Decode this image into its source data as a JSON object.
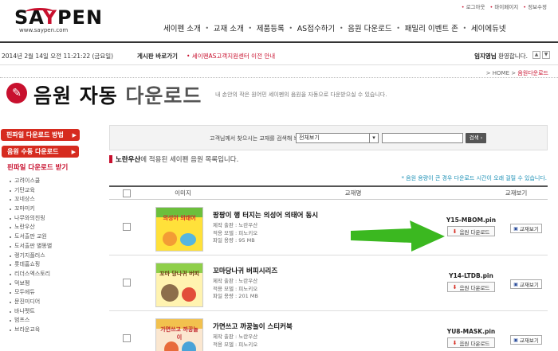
{
  "top_links": [
    "로그아웃",
    "마이페이지",
    "정보수정"
  ],
  "logo": {
    "name_prefix": "SA",
    "name_accent": "Y",
    "name_suffix": "PEN",
    "url": "www.saypen.com"
  },
  "gnb": [
    "세이펜 소개",
    "교재 소개",
    "제품등록",
    "AS접수하기",
    "음원 다운로드",
    "패밀리 이벤트 존",
    "세이에듀넷"
  ],
  "infobar": {
    "date": "2014년 2월 14일 오전 11:21:22 (금요일)",
    "bulletin_label": "게시판 바로가기",
    "bulletin_text": "세이펜AS고객지원센터 이전 안내",
    "welcome_name": "임지영님",
    "welcome_suffix": " 환영합니다."
  },
  "breadcrumb": {
    "home": "HOME",
    "sep": ">",
    "current": "음원다운로드"
  },
  "page": {
    "title_bold": "음원 자동",
    "title_light": " 다운로드",
    "desc": "내 손안의 작은 원어민 세이펜의 음원을 자동으로 다운받으실 수 있습니다."
  },
  "sidebar": {
    "buttons": [
      {
        "label": "핀파일 다운로드 방법",
        "arrow": "▶"
      },
      {
        "label": "음원 수동 다운로드",
        "arrow": "▶"
      }
    ],
    "heading": "핀파일 다운로드 받기",
    "items": [
      "고려이스쿨",
      "기탄교육",
      "꼬네상스",
      "꼬마미키",
      "나무와의친링",
      "노란우산",
      "도서출판 교원",
      "도서출판 별똥별",
      "랭기지플러스",
      "롯데홈쇼핑",
      "리더스엑스토리",
      "먹보펭",
      "모두에듀",
      "문진미디어",
      "바나펫트",
      "범프스",
      "브라운교육"
    ]
  },
  "search": {
    "label": "고객님께서 찾으시는 교재를 검색해 보세요.",
    "select_value": "전체보기",
    "input_value": "",
    "button": "검색"
  },
  "list": {
    "heading_brand": "노란우산",
    "heading_suffix": "에 적용된 세이펜 음원 목록입니다.",
    "notice": "* 음원 용량이 큰 경우 다운로드 시간이 오래 걸릴 수 있습니다.",
    "columns": {
      "image": "이미지",
      "name": "교재명",
      "view": "교재보기"
    },
    "rows": [
      {
        "title": "팡팡이 행 터지는 의성어 의태어 동시",
        "publisher": "제작 출판 : 노란우산",
        "model": "적용 모델 : 피노키오",
        "size": "파일 용량 : 95 MB",
        "filename": "Y15-MBOM.pin",
        "download": "음원 다운로드",
        "view": "교재보기",
        "thumb_text": "의성어 의태어"
      },
      {
        "title": "꼬마당나귀 버피시리즈",
        "publisher": "제작 출판 : 노란우산",
        "model": "적용 모델 : 피노키오",
        "size": "파일 용량 : 201 MB",
        "filename": "Y14-LTDB.pin",
        "download": "음원 다운로드",
        "view": "교재보기",
        "thumb_text": "꼬마 당나귀 버피"
      },
      {
        "title": "가면쓰고 까꿍놀이 스티커북",
        "publisher": "제작 출판 : 노란우산",
        "model": "적용 모델 : 피노키오",
        "size": "",
        "filename": "YU8-MASK.pin",
        "download": "음원 다운로드",
        "view": "교재보기",
        "thumb_text": "가면쓰고 까꿍놀이"
      }
    ]
  },
  "colors": {
    "accent": "#c8102e",
    "sidebar_button": "#d62b1f",
    "notice": "#1a8fb5",
    "arrow": "#3bb820"
  },
  "icons": {
    "title": "pen-icon",
    "download": "download-icon",
    "view": "book-icon",
    "arrow": "green-arrow-annotation"
  }
}
